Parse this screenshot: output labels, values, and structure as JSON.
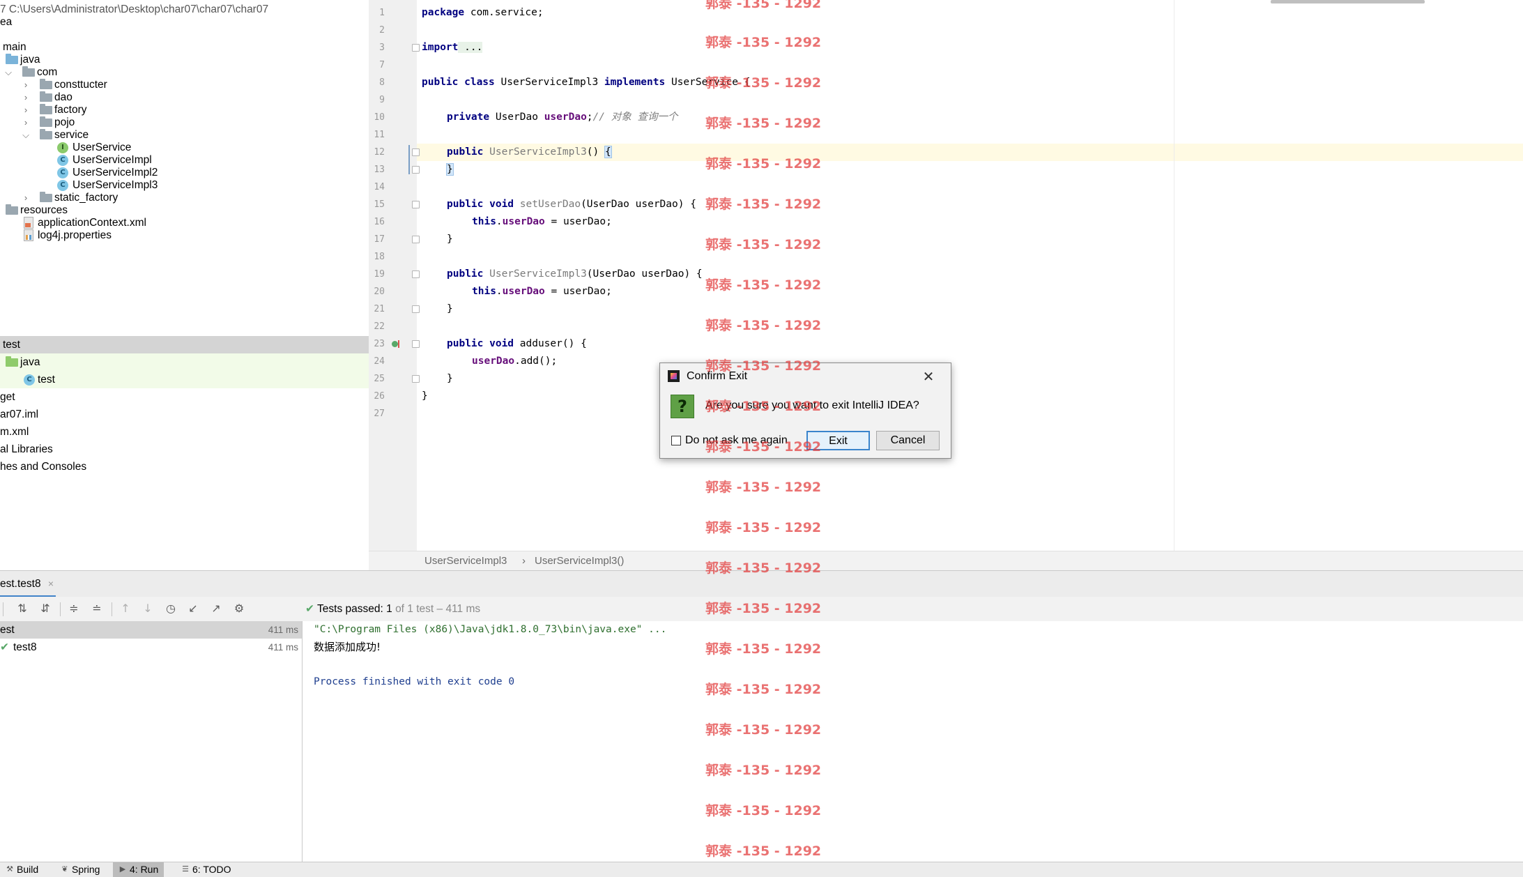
{
  "project": {
    "path_label": "7  C:\\Users\\Administrator\\Desktop\\char07\\char07\\char07",
    "items": [
      {
        "label": "ea"
      },
      {
        "label": ""
      },
      {
        "label": "main"
      },
      {
        "label": "java"
      },
      {
        "label": "com"
      },
      {
        "label": "consttucter"
      },
      {
        "label": "dao"
      },
      {
        "label": "factory"
      },
      {
        "label": "pojo"
      },
      {
        "label": "service"
      },
      {
        "label": "UserService"
      },
      {
        "label": "UserServiceImpl"
      },
      {
        "label": "UserServiceImpl2"
      },
      {
        "label": "UserServiceImpl3"
      },
      {
        "label": "static_factory"
      },
      {
        "label": "resources"
      },
      {
        "label": "applicationContext.xml"
      },
      {
        "label": "log4j.properties"
      },
      {
        "label": "test"
      },
      {
        "label": "java"
      },
      {
        "label": "test"
      },
      {
        "label": "get"
      },
      {
        "label": "ar07.iml"
      },
      {
        "label": "m.xml"
      },
      {
        "label": "al Libraries"
      },
      {
        "label": "hes and Consoles"
      }
    ]
  },
  "editor": {
    "line_numbers": [
      "1",
      "2",
      "3",
      "7",
      "8",
      "9",
      "10",
      "11",
      "12",
      "13",
      "14",
      "15",
      "16",
      "17",
      "18",
      "19",
      "20",
      "21",
      "22",
      "23",
      "24",
      "25",
      "26",
      "27"
    ],
    "code": {
      "l1_kw": "package",
      "l1_rest": " com.service;",
      "l3_kw": "import",
      "l3_rest": " ...",
      "l8_kw1": "public class",
      "l8_name": " UserServiceImpl3 ",
      "l8_kw2": "implements",
      "l8_rest": " UserService {",
      "l10_kw": "private",
      "l10_type": " UserDao ",
      "l10_fld": "userDao",
      "l10_semi": ";",
      "l10_cmt": "// 对象 查询一个",
      "l12_kw": "public",
      "l12_name": " UserServiceImpl3",
      "l12_rest": "() ",
      "l12_brace": "{",
      "l13_brace": "}",
      "l15_kw": "public void",
      "l15_name": " setUserDao",
      "l15_rest": "(UserDao userDao) {",
      "l16_kw": "this",
      "l16_dot": ".",
      "l16_fld": "userDao",
      "l16_rest": " = userDao;",
      "l17": "}",
      "l19_kw": "public",
      "l19_name": " UserServiceImpl3",
      "l19_rest": "(UserDao userDao) {",
      "l20_kw": "this",
      "l20_dot": ".",
      "l20_fld": "userDao",
      "l20_rest": " = userDao;",
      "l21": "}",
      "l23_kw": "public void",
      "l23_name": " adduser",
      "l23_rest": "() {",
      "l24_fld": "userDao",
      "l24_rest": ".add();",
      "l25": "}",
      "l26": "}"
    },
    "breadcrumbs": [
      "UserServiceImpl3",
      "›",
      "UserServiceImpl3()"
    ]
  },
  "run": {
    "tab_label": "est.test8",
    "tab_close": "×",
    "status_prefix": "Tests passed:",
    "status_count": "1",
    "status_rest": "of 1 test – 411 ms",
    "tree": [
      {
        "label": "est",
        "time": "411 ms"
      },
      {
        "label": "test8",
        "time": "411 ms"
      }
    ],
    "console": {
      "cmd": "\"C:\\Program Files (x86)\\Java\\jdk1.8.0_73\\bin\\java.exe\" ...",
      "output": "数据添加成功!",
      "exit": "Process finished with exit code 0"
    }
  },
  "bottom_tabs": [
    "Build",
    "Spring",
    "4: Run",
    "6: TODO"
  ],
  "dialog": {
    "title": "Confirm Exit",
    "message": "Are you sure you want to exit IntelliJ IDEA?",
    "checkbox_label": "Do not ask me again",
    "exit_label": "Exit",
    "cancel_label": "Cancel"
  },
  "watermark": "郭泰 -135 - 1292",
  "colors": {
    "keyword": "#000080",
    "field": "#660e7a",
    "comment": "#808080",
    "watermark": "#e23c3c",
    "test_pass": "#59a869",
    "console_cmd": "#2f6f2f",
    "console_exit": "#1f3f8f"
  }
}
